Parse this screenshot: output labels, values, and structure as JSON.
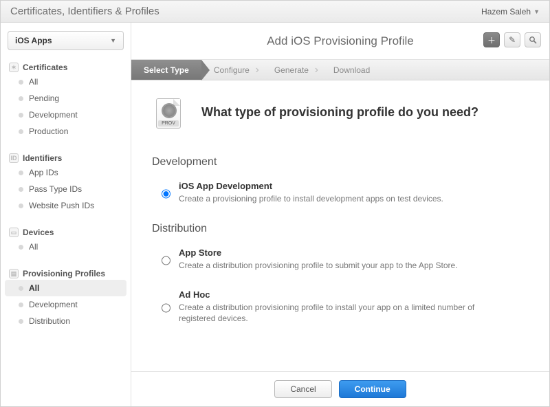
{
  "topbar": {
    "title": "Certificates, Identifiers & Profiles",
    "user": "Hazem Saleh"
  },
  "sidebar": {
    "platform": "iOS Apps",
    "groups": [
      {
        "title": "Certificates",
        "icon": "✶",
        "items": [
          "All",
          "Pending",
          "Development",
          "Production"
        ]
      },
      {
        "title": "Identifiers",
        "icon": "ID",
        "items": [
          "App IDs",
          "Pass Type IDs",
          "Website Push IDs"
        ]
      },
      {
        "title": "Devices",
        "icon": "▭",
        "items": [
          "All"
        ]
      },
      {
        "title": "Provisioning Profiles",
        "icon": "▤",
        "items": [
          "All",
          "Development",
          "Distribution"
        ],
        "selected": 0
      }
    ]
  },
  "main": {
    "title": "Add iOS Provisioning Profile",
    "steps": [
      "Select Type",
      "Configure",
      "Generate",
      "Download"
    ],
    "activeStep": 0,
    "heading": "What type of provisioning profile do you need?",
    "provBadge": "PROV",
    "sections": [
      {
        "title": "Development",
        "options": [
          {
            "id": "ios-app-dev",
            "label": "iOS App Development",
            "desc": "Create a provisioning profile to install development apps on test devices.",
            "checked": true
          }
        ]
      },
      {
        "title": "Distribution",
        "options": [
          {
            "id": "app-store",
            "label": "App Store",
            "desc": "Create a distribution provisioning profile to submit your app to the App Store.",
            "checked": false
          },
          {
            "id": "ad-hoc",
            "label": "Ad Hoc",
            "desc": "Create a distribution provisioning profile to install your app on a limited number of registered devices.",
            "checked": false
          }
        ]
      }
    ],
    "buttons": {
      "cancel": "Cancel",
      "continue": "Continue"
    }
  }
}
